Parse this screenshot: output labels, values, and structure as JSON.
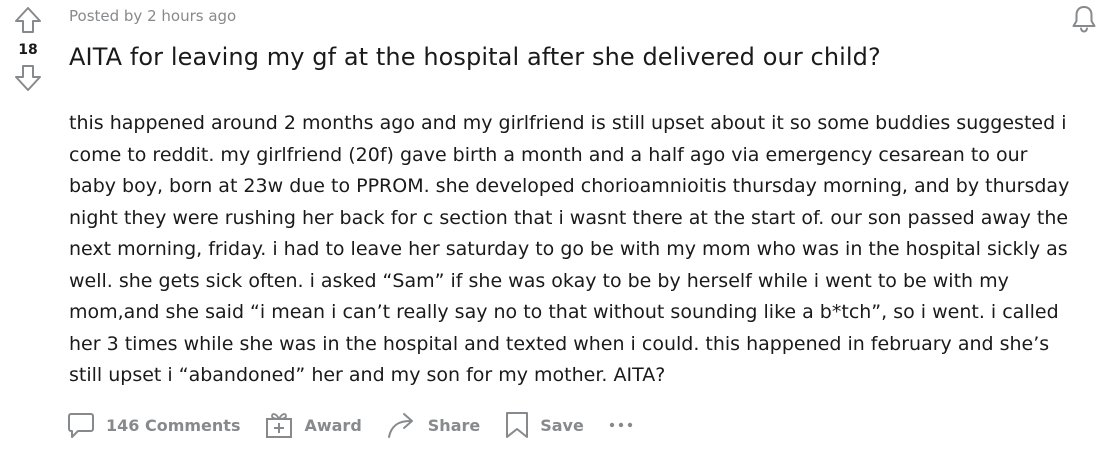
{
  "vote": {
    "score": "18",
    "upvote_icon": "arrow-up-outline-icon",
    "downvote_icon": "arrow-down-outline-icon"
  },
  "post": {
    "meta": "Posted by 2 hours ago",
    "title": "AITA for leaving my gf at the hospital after she delivered our child?",
    "body": "this happened around 2 months ago and my girlfriend is still upset about it so some buddies suggested i come to reddit. my girlfriend (20f) gave birth a month and a half ago via emergency cesarean to our baby boy, born at 23w due to PPROM. she developed chorioamnioitis thursday morning, and by thursday night they were rushing her back for c section that i wasnt there at the start of. our son passed away the next morning, friday. i had to leave her saturday to go be with my mom who was in the hospital sickly as well. she gets sick often. i asked “Sam” if she was okay to be by herself while i went to be with my mom,and she said “i mean i can’t really say no to that without sounding like a b*tch”, so i went. i called her 3 times while she was in the hospital and texted when i could. this happened in february and she’s still upset i “abandoned” her and my son for my mother. AITA?",
    "bell_icon": "bell-icon"
  },
  "actions": {
    "comments_label": "146 Comments",
    "award_label": "Award",
    "share_label": "Share",
    "save_label": "Save",
    "more_icon": "more-dots-icon"
  },
  "colors": {
    "text": "#1a1a1b",
    "muted": "#878a8c",
    "background": "#ffffff"
  }
}
